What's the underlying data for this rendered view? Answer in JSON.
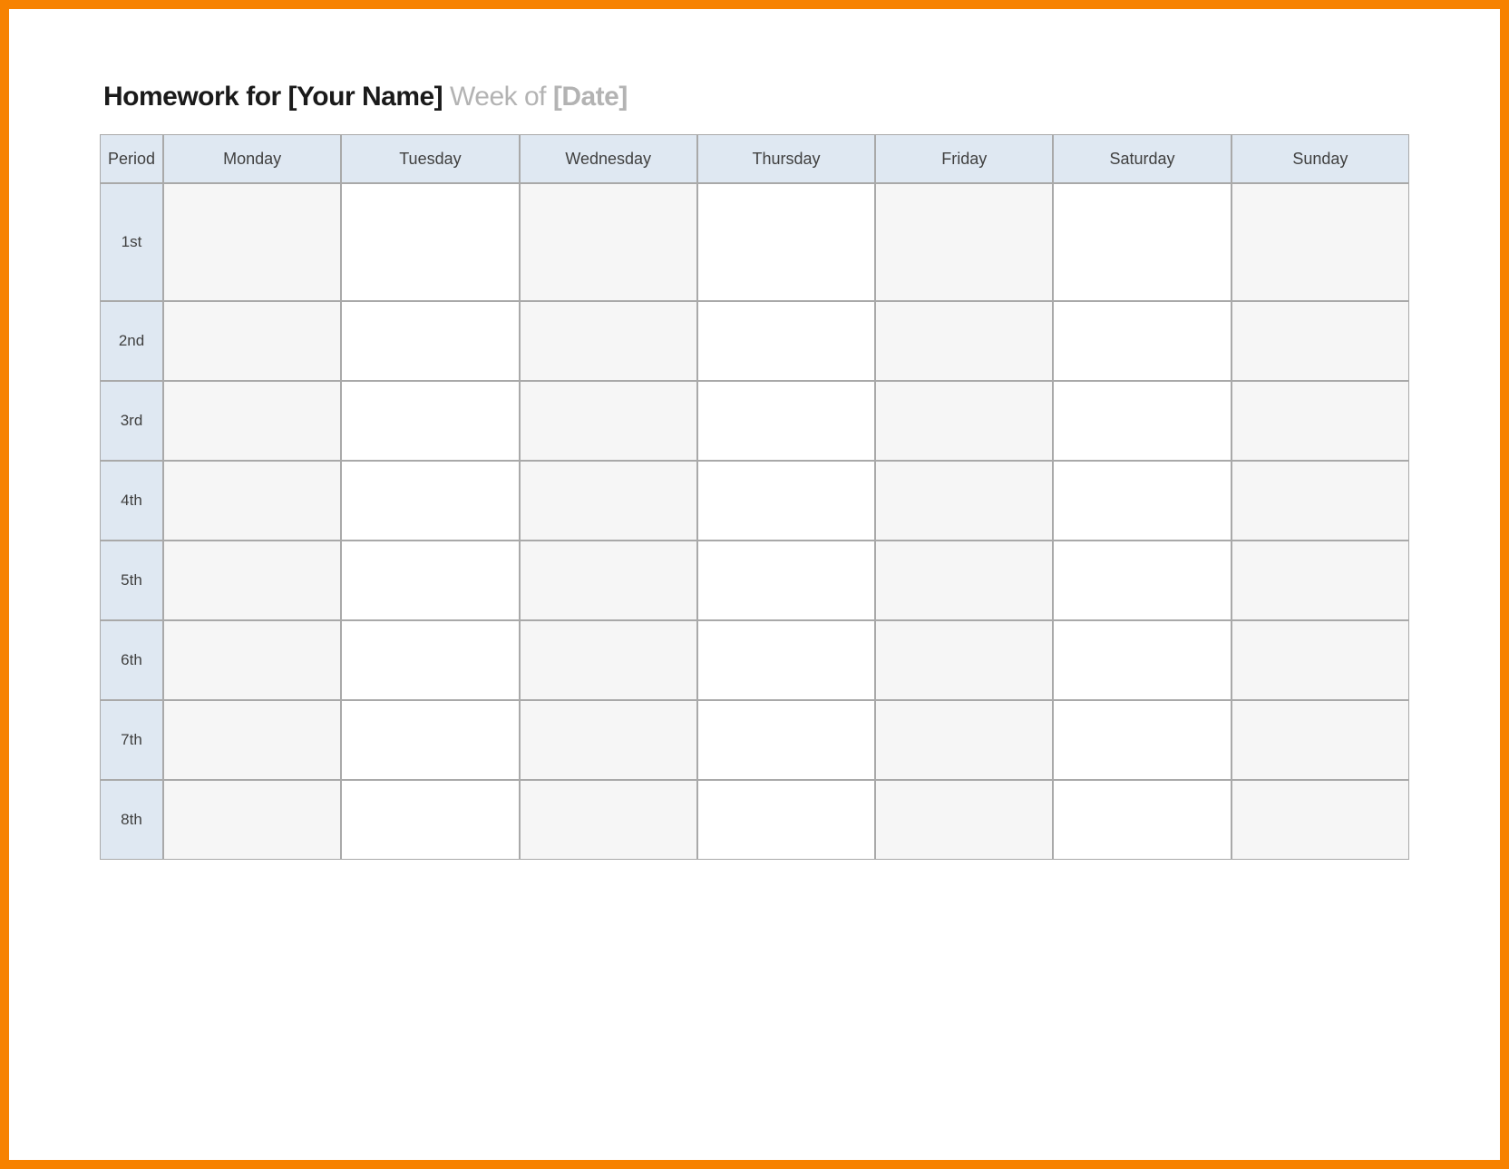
{
  "title": {
    "prefix_bold": "Homework for ",
    "name_placeholder_bold": "[Your Name]",
    "week_label_grey": " Week of ",
    "date_placeholder_grey_bold": "[Date]"
  },
  "columns": [
    "Period",
    "Monday",
    "Tuesday",
    "Wednesday",
    "Thursday",
    "Friday",
    "Saturday",
    "Sunday"
  ],
  "periods": [
    "1st",
    "2nd",
    "3rd",
    "4th",
    "5th",
    "6th",
    "7th",
    "8th"
  ],
  "cells": [
    [
      "",
      "",
      "",
      "",
      "",
      "",
      ""
    ],
    [
      "",
      "",
      "",
      "",
      "",
      "",
      ""
    ],
    [
      "",
      "",
      "",
      "",
      "",
      "",
      ""
    ],
    [
      "",
      "",
      "",
      "",
      "",
      "",
      ""
    ],
    [
      "",
      "",
      "",
      "",
      "",
      "",
      ""
    ],
    [
      "",
      "",
      "",
      "",
      "",
      "",
      ""
    ],
    [
      "",
      "",
      "",
      "",
      "",
      "",
      ""
    ],
    [
      "",
      "",
      "",
      "",
      "",
      "",
      ""
    ]
  ]
}
